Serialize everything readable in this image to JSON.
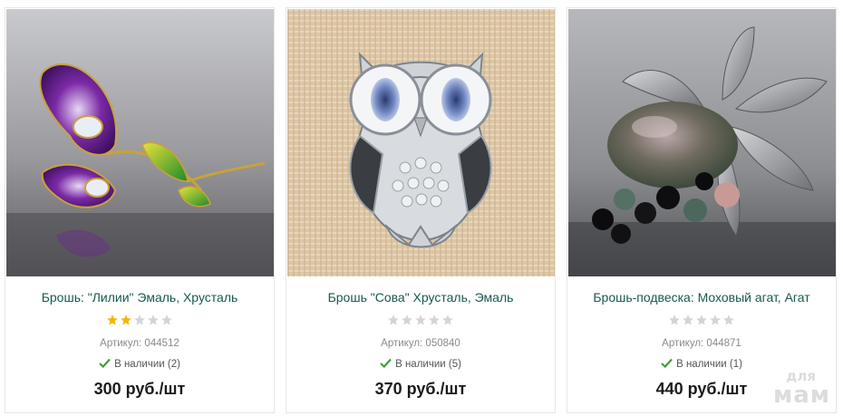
{
  "products": [
    {
      "title": "Брошь: \"Лилии\" Эмаль, Хрусталь",
      "rating": 2,
      "max_rating": 5,
      "sku": "Артикул: 044512",
      "stock": "В наличии (2)",
      "price": "300 руб./шт"
    },
    {
      "title": "Брошь \"Сова\" Хрусталь, Эмаль",
      "rating": 0,
      "max_rating": 5,
      "sku": "Артикул: 050840",
      "stock": "В наличии (5)",
      "price": "370 руб./шт"
    },
    {
      "title": "Брошь-подвеска: Моховый агат, Агат",
      "rating": 0,
      "max_rating": 5,
      "sku": "Артикул: 044871",
      "stock": "В наличии (1)",
      "price": "440 руб./шт"
    }
  ],
  "icons": {
    "stock": "checkmark-icon",
    "rating": "star-icon"
  },
  "colors": {
    "title": "#17594f",
    "star_filled": "#f2b705",
    "star_empty": "#d4d4d4",
    "check": "#3aa335"
  },
  "watermark": {
    "line1": "для",
    "line2": "мам"
  }
}
